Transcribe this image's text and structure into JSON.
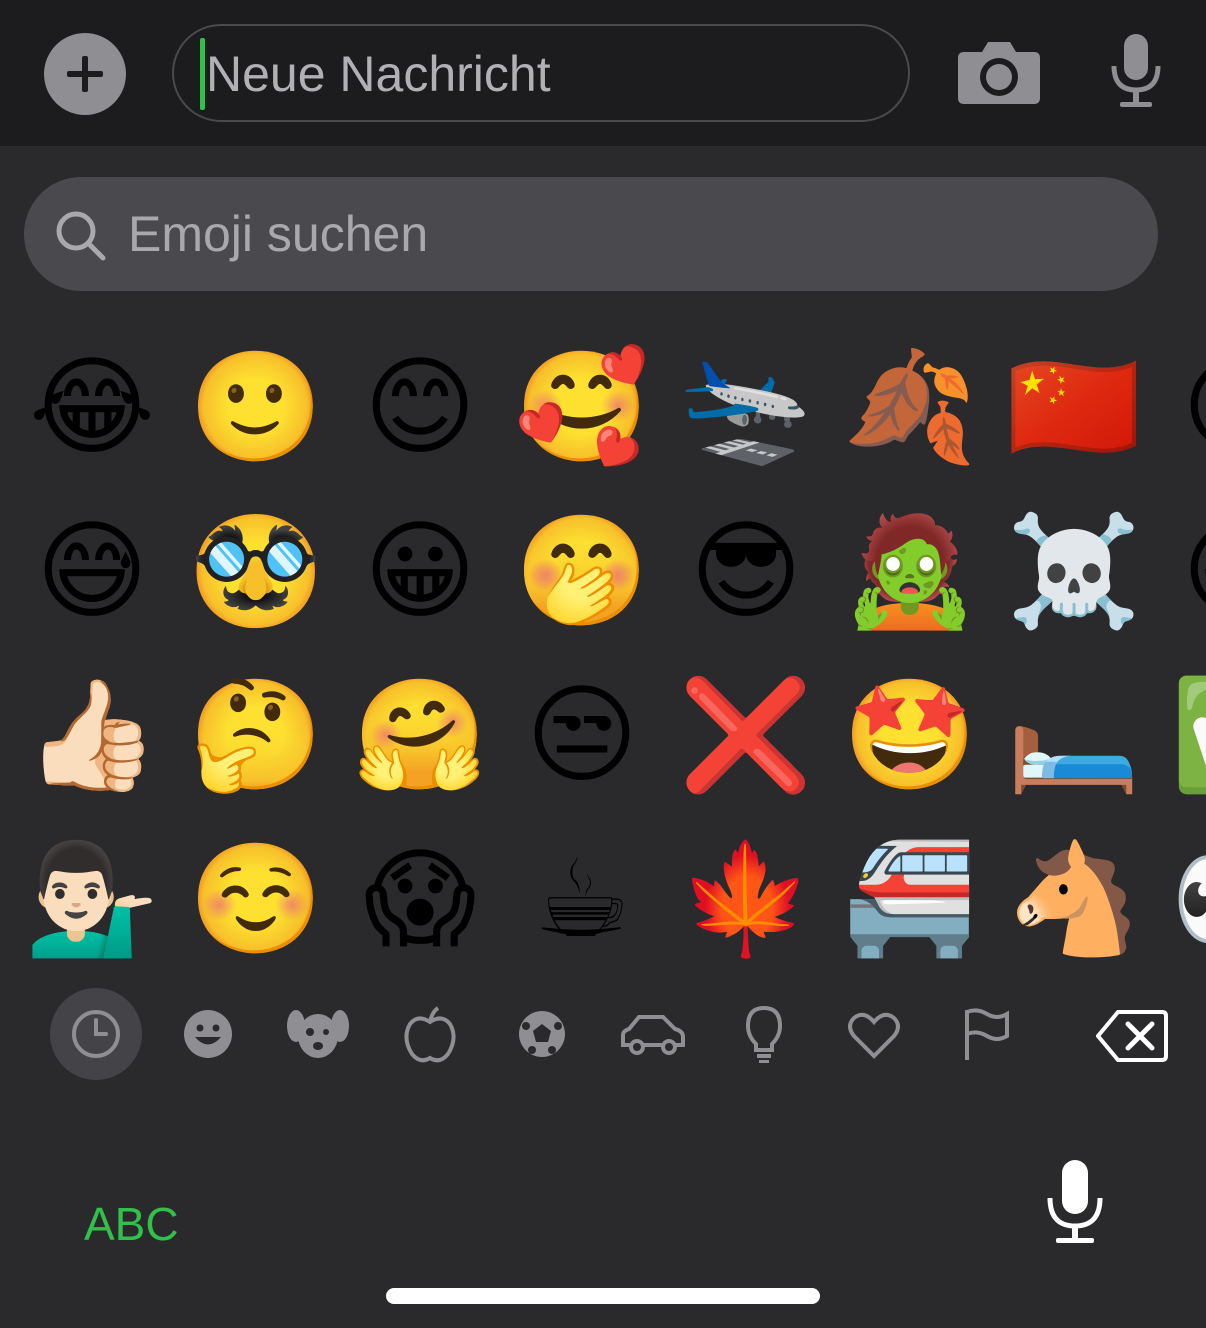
{
  "input": {
    "placeholder": "Neue Nachricht",
    "add_icon": "plus-icon",
    "camera_icon": "camera-icon",
    "mic_icon": "microphone-icon"
  },
  "search": {
    "placeholder": "Emoji suchen",
    "icon": "search-icon"
  },
  "emoji_rows": [
    [
      "😂",
      "🙂",
      "😊",
      "🥰",
      "🛬",
      "🍂",
      "🇨🇳",
      "😍"
    ],
    [
      "😅",
      "🥸",
      "😀",
      "🤭",
      "😎",
      "🧟",
      "☠️",
      "😀"
    ],
    [
      "👍🏻",
      "🤔",
      "🤗",
      "😒",
      "❌",
      "🤩",
      "🛏️",
      "✅"
    ],
    [
      "💁🏻‍♂️",
      "☺️",
      "😱",
      "☕",
      "🍁",
      "🚝",
      "🐴",
      "👀"
    ]
  ],
  "categories": [
    {
      "name": "recent",
      "icon": "clock-icon",
      "active": true
    },
    {
      "name": "smileys",
      "icon": "smiley-icon"
    },
    {
      "name": "animals",
      "icon": "dog-icon"
    },
    {
      "name": "food",
      "icon": "apple-icon"
    },
    {
      "name": "activity",
      "icon": "ball-icon"
    },
    {
      "name": "travel",
      "icon": "car-icon"
    },
    {
      "name": "objects",
      "icon": "lightbulb-icon"
    },
    {
      "name": "symbols",
      "icon": "heart-icon"
    },
    {
      "name": "flags",
      "icon": "flag-icon"
    }
  ],
  "keyboard": {
    "abc_label": "ABC",
    "backspace_icon": "backspace-icon",
    "dictation_icon": "microphone-icon"
  },
  "colors": {
    "accent_green": "#2fc14a",
    "background": "#2a2a2c",
    "topbar": "#1c1c1e"
  }
}
